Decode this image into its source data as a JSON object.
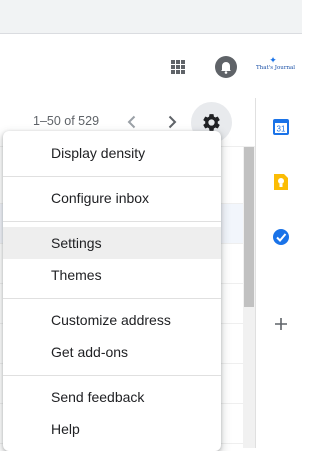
{
  "header": {
    "apps_icon": "apps-grid-icon",
    "notifications_icon": "bell-icon",
    "logo_text": "That's Journal"
  },
  "toolbar": {
    "pager_text": "1–50 of 529",
    "prev_icon": "chevron-left-icon",
    "next_icon": "chevron-right-icon",
    "settings_icon": "gear-icon"
  },
  "settings_menu": {
    "items": [
      {
        "label": "Display density"
      },
      {
        "label": "Configure inbox"
      },
      {
        "label": "Settings",
        "active": true
      },
      {
        "label": "Themes"
      },
      {
        "label": "Customize address"
      },
      {
        "label": "Get add-ons"
      },
      {
        "label": "Send feedback"
      },
      {
        "label": "Help"
      }
    ]
  },
  "side_panel": {
    "apps": [
      "calendar-icon",
      "keep-icon",
      "tasks-icon"
    ],
    "calendar_day": "31",
    "add_icon": "plus-icon"
  },
  "colors": {
    "accent": "#1a73e8",
    "keep_yellow": "#fbbc04",
    "menu_highlight": "#eeeeee"
  }
}
